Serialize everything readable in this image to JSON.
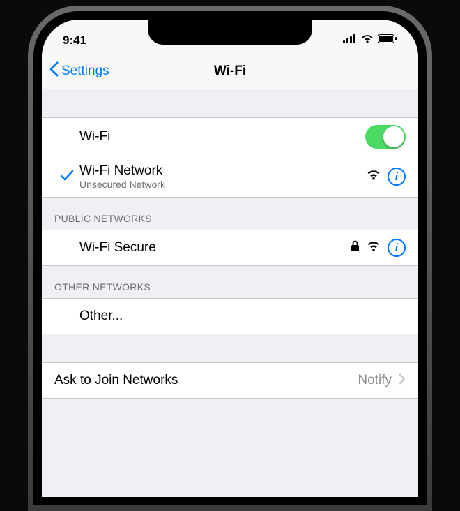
{
  "status": {
    "time": "9:41"
  },
  "nav": {
    "back": "Settings",
    "title": "Wi-Fi"
  },
  "toggle": {
    "label": "Wi-Fi",
    "on": true
  },
  "connected": {
    "name": "Wi-Fi Network",
    "subtitle": "Unsecured Network"
  },
  "sections": {
    "public": {
      "header": "PUBLIC NETWORKS",
      "items": [
        {
          "name": "Wi-Fi Secure",
          "locked": true
        }
      ]
    },
    "other": {
      "header": "OTHER NETWORKS",
      "other_label": "Other..."
    }
  },
  "ask": {
    "label": "Ask to Join Networks",
    "value": "Notify"
  }
}
